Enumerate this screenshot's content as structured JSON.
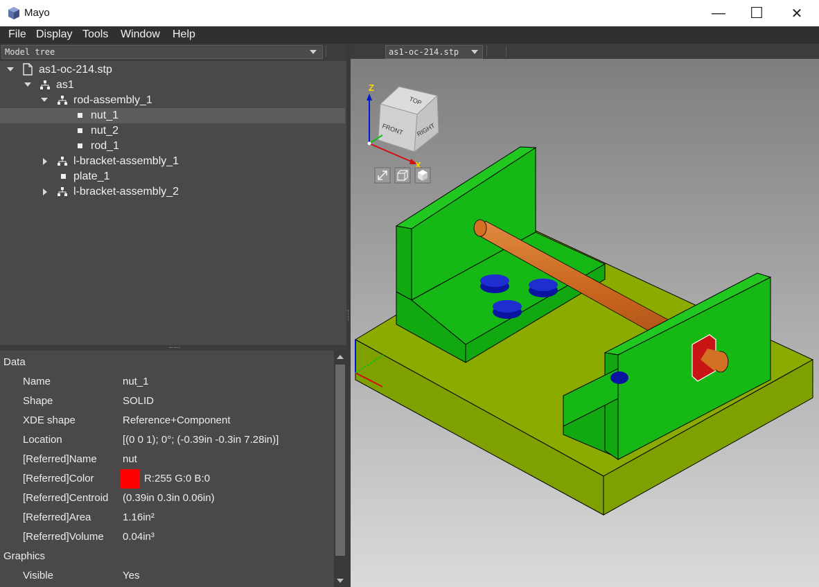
{
  "window": {
    "title": "Mayo",
    "minimize": "—",
    "maximize": "☐",
    "close": "✕"
  },
  "menu": [
    "File",
    "Display",
    "Tools",
    "Window",
    "Help"
  ],
  "left": {
    "combo_label": "Model tree"
  },
  "tree": [
    {
      "label": "as1-oc-214.stp",
      "icon": "file-icon",
      "expander": "down",
      "depth": 0
    },
    {
      "label": "as1",
      "icon": "assembly-icon",
      "expander": "down",
      "depth": 1
    },
    {
      "label": "rod-assembly_1",
      "icon": "assembly-icon",
      "expander": "down",
      "depth": 2
    },
    {
      "label": "nut_1",
      "icon": "part-icon",
      "expander": "",
      "depth": 3,
      "selected": true
    },
    {
      "label": "nut_2",
      "icon": "part-icon",
      "expander": "",
      "depth": 3
    },
    {
      "label": "rod_1",
      "icon": "part-icon",
      "expander": "",
      "depth": 3
    },
    {
      "label": "l-bracket-assembly_1",
      "icon": "assembly-icon",
      "expander": "right",
      "depth": 2
    },
    {
      "label": "plate_1",
      "icon": "part-icon",
      "expander": "",
      "depth": 2
    },
    {
      "label": "l-bracket-assembly_2",
      "icon": "assembly-icon",
      "expander": "right",
      "depth": 2
    }
  ],
  "props": {
    "section_data": "Data",
    "section_graphics": "Graphics",
    "rows": [
      {
        "k": "Name",
        "v": "nut_1"
      },
      {
        "k": "Shape",
        "v": "SOLID"
      },
      {
        "k": "XDE shape",
        "v": "Reference+Component"
      },
      {
        "k": "Location",
        "v": "[(0 0 1); 0°; (-0.39in -0.3in 7.28in)]"
      },
      {
        "k": "[Referred]Name",
        "v": "nut"
      },
      {
        "k": "[Referred]Color",
        "v": "R:255 G:0 B:0"
      },
      {
        "k": "[Referred]Centroid",
        "v": "(0.39in 0.3in 0.06in)"
      },
      {
        "k": "[Referred]Area",
        "v": "1.16in²"
      },
      {
        "k": "[Referred]Volume",
        "v": "0.04in³"
      }
    ],
    "visible_key": "Visible",
    "visible_val": "Yes",
    "color_hex": "#ff0000"
  },
  "viewport": {
    "document": "as1-oc-214.stp",
    "cube": {
      "top": "TOP",
      "front": "FRONT",
      "right": "RIGHT"
    },
    "axis_z": "Z",
    "axis_x": "X"
  },
  "colors": {
    "bracket": "#11bb11",
    "plate": "#8cab00",
    "rod": "#d2691e",
    "nut_blue": "#0a14a0",
    "nut_red": "#c81414"
  }
}
